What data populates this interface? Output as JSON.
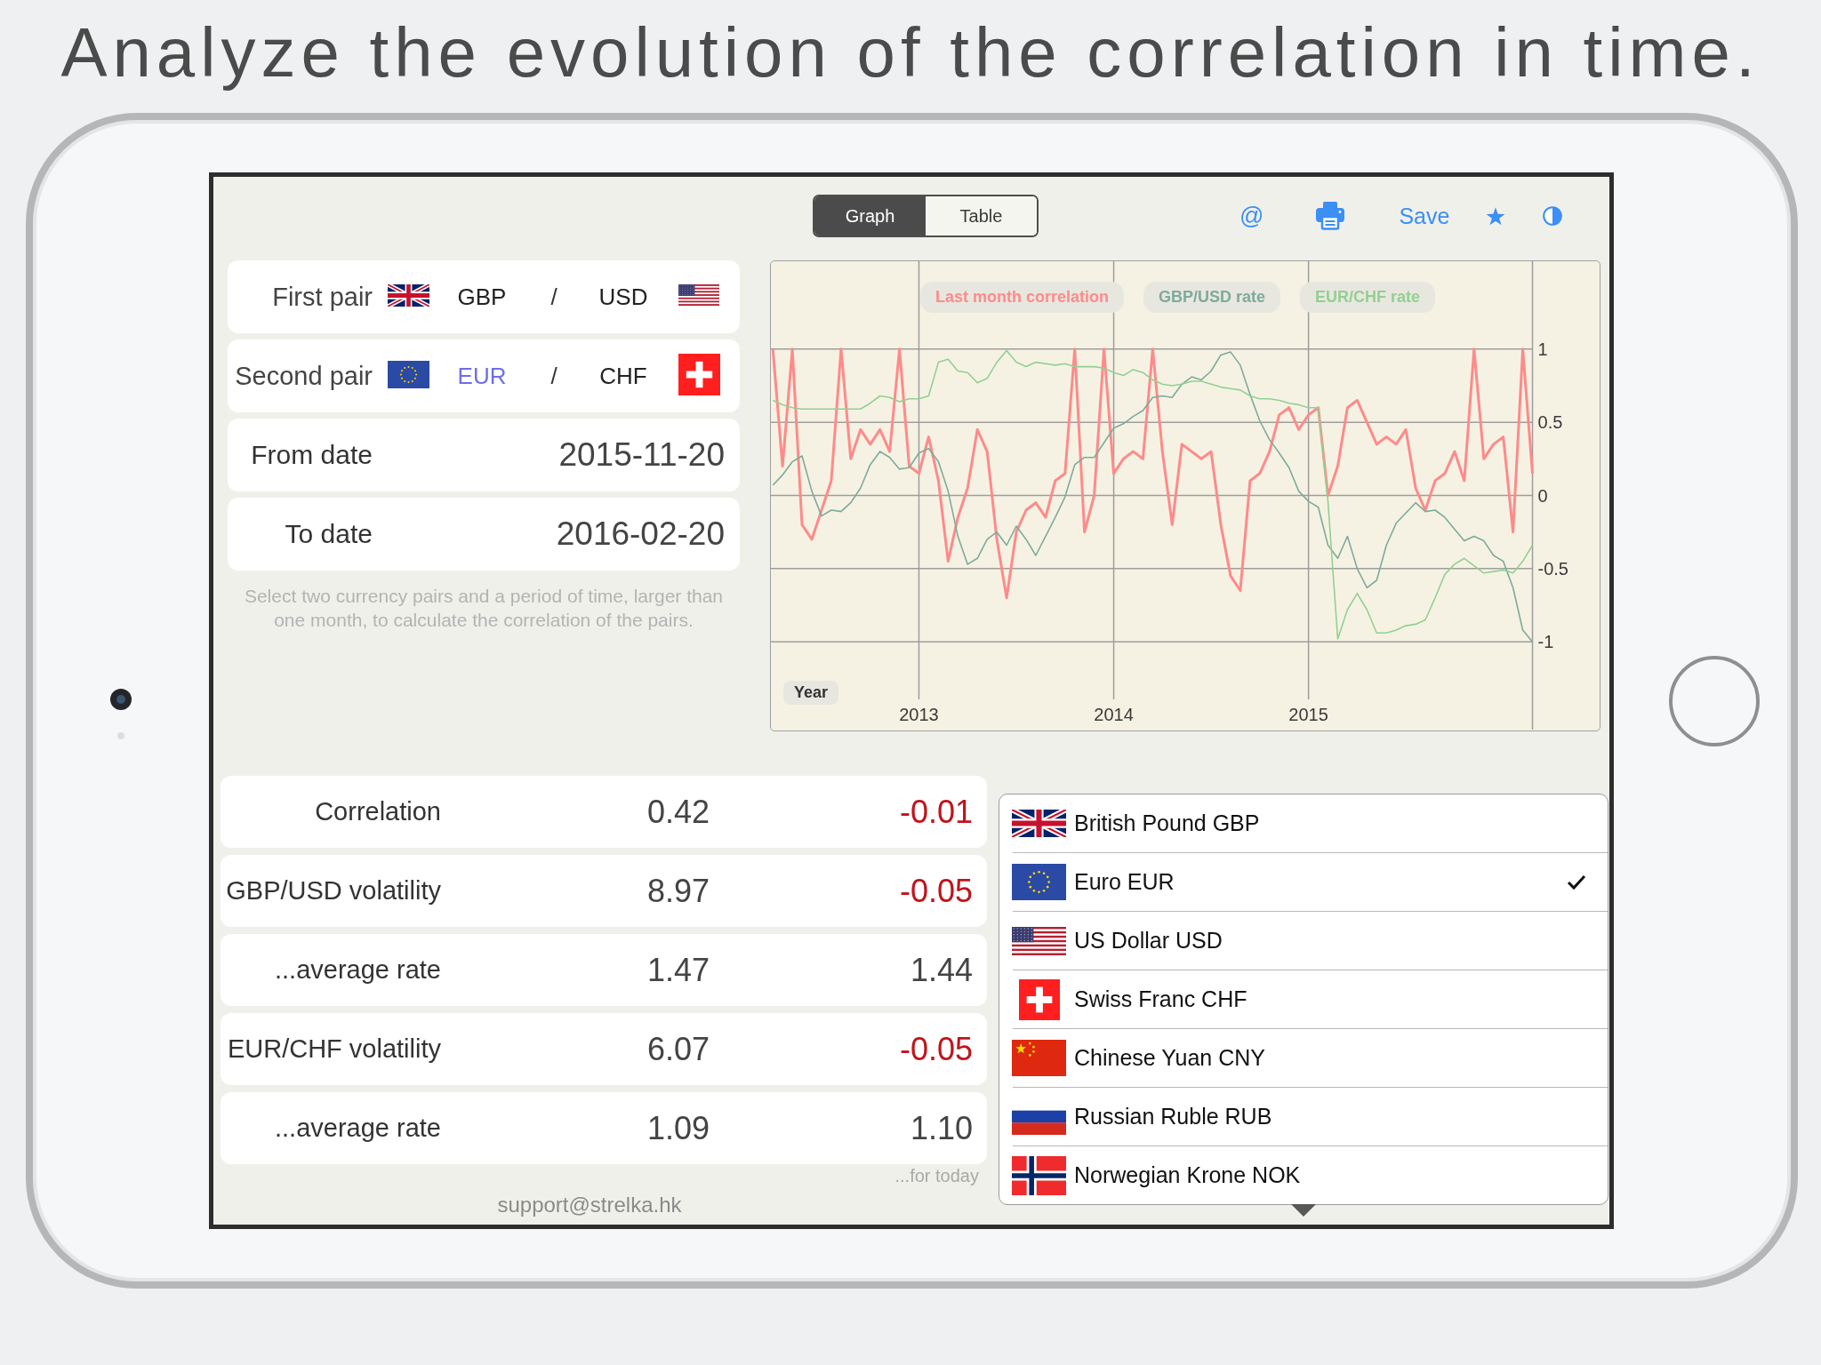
{
  "headline": "Analyze the evolution of the correlation in time.",
  "toolbar": {
    "view_tabs": [
      {
        "label": "Graph",
        "selected": true
      },
      {
        "label": "Table",
        "selected": false
      }
    ],
    "email_glyph": "@",
    "save_label": "Save"
  },
  "pairs": [
    {
      "label": "First pair",
      "base": {
        "code": "GBP",
        "kind": "britain",
        "selected": false
      },
      "separator": "/",
      "quote": {
        "code": "USD",
        "kind": "usa",
        "selected": false
      }
    },
    {
      "label": "Second pair",
      "base": {
        "code": "EUR",
        "kind": "europe",
        "selected": true
      },
      "separator": "/",
      "quote": {
        "code": "CHF",
        "kind": "switzerland",
        "selected": false
      }
    }
  ],
  "dates": [
    {
      "label": "From date",
      "value": "2015-11-20"
    },
    {
      "label": "To date",
      "value": "2016-02-20"
    }
  ],
  "hint": "Select two currency pairs and a period of time, larger than one month, to calculate the correlation of the pairs.",
  "chart": {
    "chart_data": [
      {
        "type": "line",
        "xlabel": "Year",
        "legend": "top",
        "grid": true,
        "xlim": [
          2012.24,
          2016.49
        ],
        "ylim": [
          -1.6,
          1.6
        ],
        "xticks": [
          2013,
          2014,
          2015
        ],
        "yticks": [
          -1,
          -0.5,
          0,
          0.5,
          1
        ],
        "x": [
          2012.25,
          2012.3,
          2012.35,
          2012.4,
          2012.45,
          2012.5,
          2012.55,
          2012.6,
          2012.65,
          2012.7,
          2012.75,
          2012.8,
          2012.85,
          2012.9,
          2012.95,
          2013,
          2013.05,
          2013.1,
          2013.15,
          2013.2,
          2013.25,
          2013.3,
          2013.35,
          2013.4,
          2013.45,
          2013.5,
          2013.55,
          2013.6,
          2013.65,
          2013.7,
          2013.75,
          2013.8,
          2013.85,
          2013.9,
          2013.95,
          2014,
          2014.05,
          2014.1,
          2014.15,
          2014.2,
          2014.25,
          2014.3,
          2014.35,
          2014.4,
          2014.45,
          2014.5,
          2014.55,
          2014.6,
          2014.65,
          2014.7,
          2014.75,
          2014.8,
          2014.85,
          2014.9,
          2014.95,
          2015,
          2015.05,
          2015.1,
          2015.15,
          2015.2,
          2015.25,
          2015.3,
          2015.35,
          2015.4,
          2015.45,
          2015.5,
          2015.55,
          2015.6,
          2015.65,
          2015.7,
          2015.75,
          2015.8,
          2015.85,
          2015.9,
          2015.95,
          2016,
          2016.05,
          2016.1,
          2016.15
        ],
        "series": [
          {
            "name": "Last month correlation",
            "color": "#ff8a8a",
            "values": [
              1.0,
              0.2,
              1.0,
              -0.2,
              -0.3,
              -0.1,
              0.1,
              1.0,
              0.25,
              0.45,
              0.35,
              0.45,
              0.3,
              1.0,
              0.2,
              0.15,
              0.4,
              0.1,
              -0.45,
              -0.15,
              0.05,
              0.45,
              0.3,
              -0.3,
              -0.7,
              -0.25,
              -0.1,
              -0.05,
              -0.15,
              0.1,
              0.15,
              1.0,
              -0.25,
              0.0,
              1.0,
              0.15,
              0.25,
              0.3,
              0.25,
              1.0,
              0.3,
              -0.2,
              0.35,
              0.3,
              0.25,
              0.3,
              -0.2,
              -0.55,
              -0.65,
              0.1,
              0.15,
              0.3,
              0.55,
              0.6,
              0.45,
              0.55,
              0.6,
              0.0,
              0.2,
              0.6,
              0.65,
              0.5,
              0.35,
              0.4,
              0.35,
              0.45,
              0.05,
              -0.1,
              0.1,
              0.15,
              0.3,
              0.1,
              1.0,
              0.25,
              0.35,
              0.4,
              -0.25,
              1.0,
              0.15
            ]
          },
          {
            "name": "GBP/USD rate",
            "color": "#7dab9c",
            "values": [
              0.07,
              0.14,
              0.23,
              0.27,
              0.03,
              -0.14,
              -0.1,
              -0.11,
              -0.05,
              0.05,
              0.21,
              0.3,
              0.26,
              0.18,
              0.19,
              0.29,
              0.32,
              0.23,
              0.03,
              -0.28,
              -0.47,
              -0.43,
              -0.3,
              -0.25,
              -0.34,
              -0.21,
              -0.3,
              -0.41,
              -0.28,
              -0.15,
              -0.01,
              0.21,
              0.26,
              0.26,
              0.36,
              0.46,
              0.49,
              0.54,
              0.58,
              0.67,
              0.68,
              0.67,
              0.76,
              0.81,
              0.79,
              0.85,
              0.96,
              0.98,
              0.89,
              0.69,
              0.51,
              0.38,
              0.29,
              0.19,
              0.03,
              -0.04,
              -0.08,
              -0.34,
              -0.43,
              -0.28,
              -0.5,
              -0.63,
              -0.58,
              -0.34,
              -0.19,
              -0.12,
              -0.05,
              -0.11,
              -0.1,
              -0.15,
              -0.23,
              -0.31,
              -0.28,
              -0.31,
              -0.41,
              -0.45,
              -0.63,
              -0.92,
              -1.0
            ]
          },
          {
            "name": "EUR/CHF rate",
            "color": "#92d092",
            "values": [
              0.65,
              0.62,
              0.6,
              0.59,
              0.59,
              0.59,
              0.59,
              0.59,
              0.59,
              0.59,
              0.63,
              0.68,
              0.67,
              0.64,
              0.66,
              0.66,
              0.68,
              0.91,
              0.93,
              0.85,
              0.84,
              0.77,
              0.8,
              0.91,
              0.99,
              0.91,
              0.88,
              0.91,
              0.9,
              0.89,
              0.9,
              0.88,
              0.88,
              0.88,
              0.87,
              0.84,
              0.82,
              0.86,
              0.84,
              0.79,
              0.76,
              0.75,
              0.76,
              0.78,
              0.78,
              0.76,
              0.74,
              0.73,
              0.72,
              0.68,
              0.66,
              0.66,
              0.65,
              0.63,
              0.62,
              0.6,
              0.6,
              -0.04,
              -0.98,
              -0.78,
              -0.67,
              -0.78,
              -0.94,
              -0.94,
              -0.92,
              -0.89,
              -0.88,
              -0.85,
              -0.7,
              -0.54,
              -0.47,
              -0.43,
              -0.48,
              -0.53,
              -0.52,
              -0.51,
              -0.53,
              -0.45,
              -0.34
            ]
          }
        ]
      }
    ]
  },
  "stats": {
    "rows": [
      {
        "label": "Correlation",
        "value": "0.42",
        "today": "-0.01",
        "negative": true
      },
      {
        "label": "GBP/USD volatility",
        "value": "8.97",
        "today": "-0.05",
        "negative": true
      },
      {
        "label": "...average rate",
        "value": "1.47",
        "today": "1.44",
        "negative": false
      },
      {
        "label": "EUR/CHF volatility",
        "value": "6.07",
        "today": "-0.05",
        "negative": true
      },
      {
        "label": "...average rate",
        "value": "1.09",
        "today": "1.10",
        "negative": false
      }
    ],
    "today_caption": "...for today"
  },
  "support_link": "support@strelka.hk",
  "currency_picker": {
    "items": [
      {
        "name": "British Pound GBP",
        "kind": "britain",
        "selected": false
      },
      {
        "name": "Euro EUR",
        "kind": "europe",
        "selected": true
      },
      {
        "name": "US Dollar USD",
        "kind": "usa",
        "selected": false
      },
      {
        "name": "Swiss Franc CHF",
        "kind": "switzerland",
        "selected": false
      },
      {
        "name": "Chinese Yuan CNY",
        "kind": "china",
        "selected": false
      },
      {
        "name": "Russian Ruble RUB",
        "kind": "russia",
        "selected": false
      },
      {
        "name": "Norwegian Krone NOK",
        "kind": "norway",
        "selected": false
      }
    ]
  }
}
